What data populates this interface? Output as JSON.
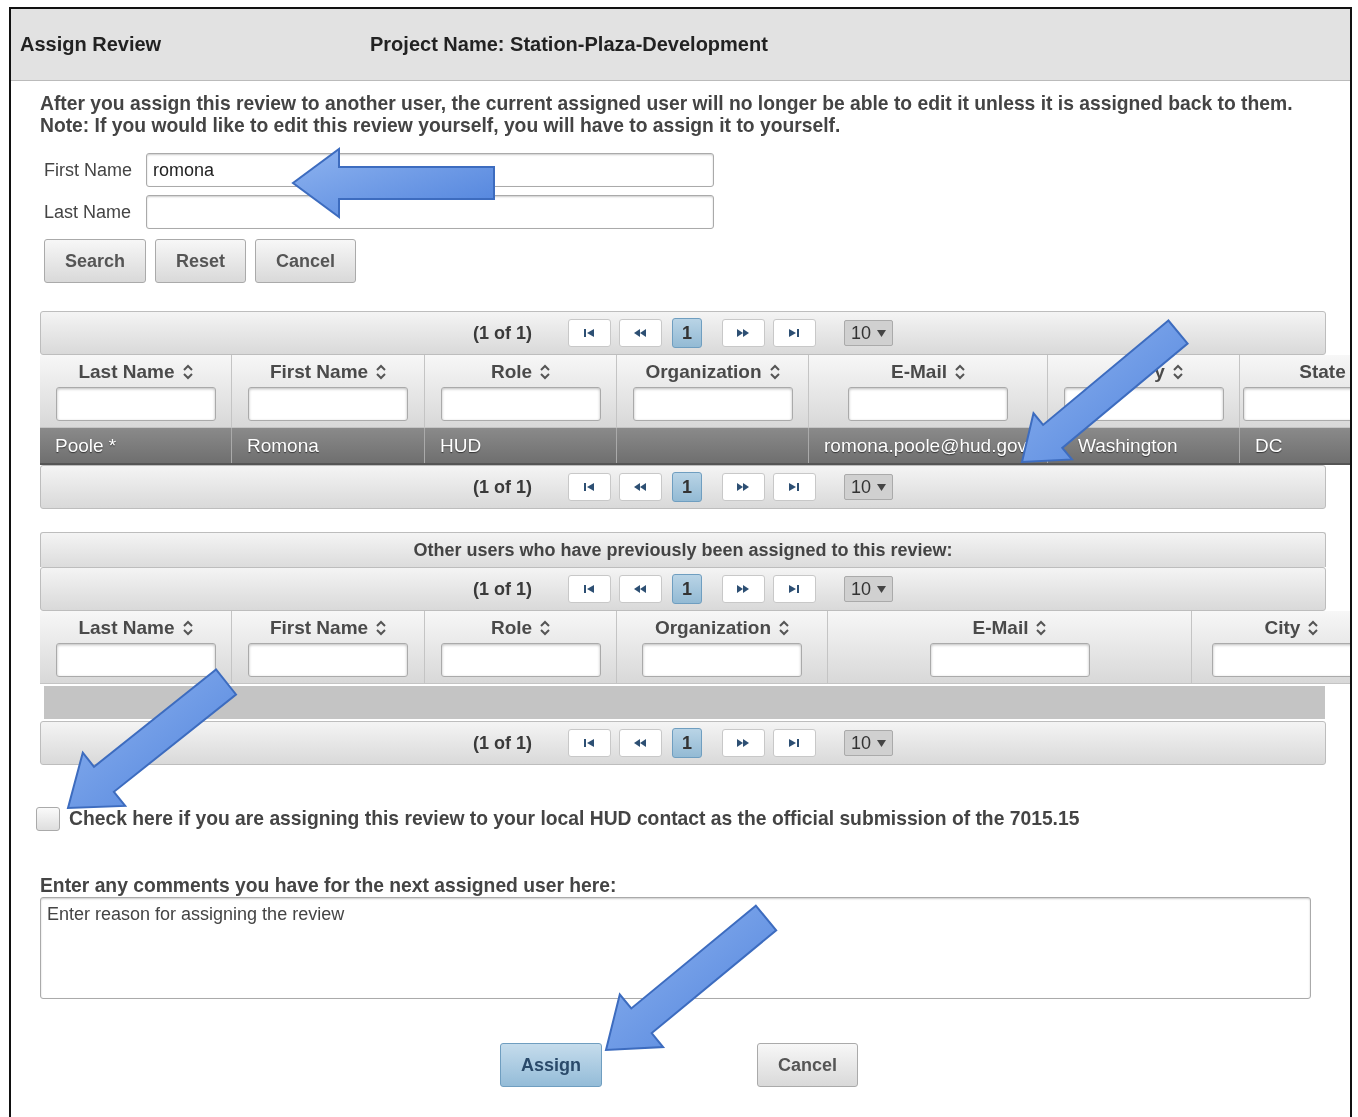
{
  "dialog": {
    "title": "Assign Review",
    "project": "Project Name: Station-Plaza-Development"
  },
  "instructions": [
    "After you assign this review to another user, the current assigned user will no longer be able to edit it unless it is assigned back to them.",
    "Note: If you would like to edit this review yourself, you will have to assign it to yourself."
  ],
  "search_form": {
    "fields": [
      {
        "label": "First Name",
        "value": "romona"
      },
      {
        "label": "Last Name"
      }
    ],
    "buttons": [
      "Search",
      "Reset",
      "Cancel"
    ]
  },
  "results_table": {
    "pager_top": {
      "status": "(1 of 1)",
      "pages": [
        {
          "label": "1",
          "selected": true
        }
      ],
      "rows_per_page": "10"
    },
    "columns": [
      {
        "label": "Last Name",
        "sortable": true
      },
      {
        "label": "First Name",
        "sortable": true
      },
      {
        "label": "Role",
        "sortable": true
      },
      {
        "label": "Organization",
        "sortable": true
      },
      {
        "label": "E-Mail",
        "sortable": true
      },
      {
        "label": "y",
        "sortable": true
      },
      {
        "label": "State",
        "sortable": false
      }
    ],
    "rows": [
      {
        "selected": true,
        "cells": [
          "Poole *",
          "Romona",
          "HUD",
          null,
          "romona.poole@hud.gov",
          "Washington",
          "DC"
        ]
      }
    ],
    "pager_bottom": {
      "status": "(1 of 1)",
      "pages": [
        {
          "label": "1",
          "selected": true
        }
      ],
      "rows_per_page": "10"
    }
  },
  "previous_table": {
    "caption": "Other users who have previously been assigned to this review:",
    "pager_top": {
      "status": "(1 of 1)",
      "pages": [
        {
          "label": "1",
          "selected": true
        }
      ],
      "rows_per_page": "10"
    },
    "columns": [
      {
        "label": "Last Name",
        "sortable": true
      },
      {
        "label": "First Name",
        "sortable": true
      },
      {
        "label": "Role",
        "sortable": true
      },
      {
        "label": "Organization",
        "sortable": true
      },
      {
        "label": "E-Mail",
        "sortable": true
      },
      {
        "label": "City",
        "sortable": true
      }
    ],
    "pager_bottom": {
      "status": "(1 of 1)",
      "pages": [
        {
          "label": "1",
          "selected": true
        }
      ],
      "rows_per_page": "10"
    }
  },
  "official_submission": {
    "label": "Check here if you are assigning this review to your local HUD contact as the official submission of the 7015.15",
    "checked": false
  },
  "comments": {
    "label": "Enter any comments you have for the next assigned user here:",
    "placeholder": "Enter reason for assigning the review"
  },
  "actions": [
    {
      "label": "Assign",
      "kind": "primary"
    },
    {
      "label": "Cancel",
      "kind": "secondary"
    }
  ]
}
